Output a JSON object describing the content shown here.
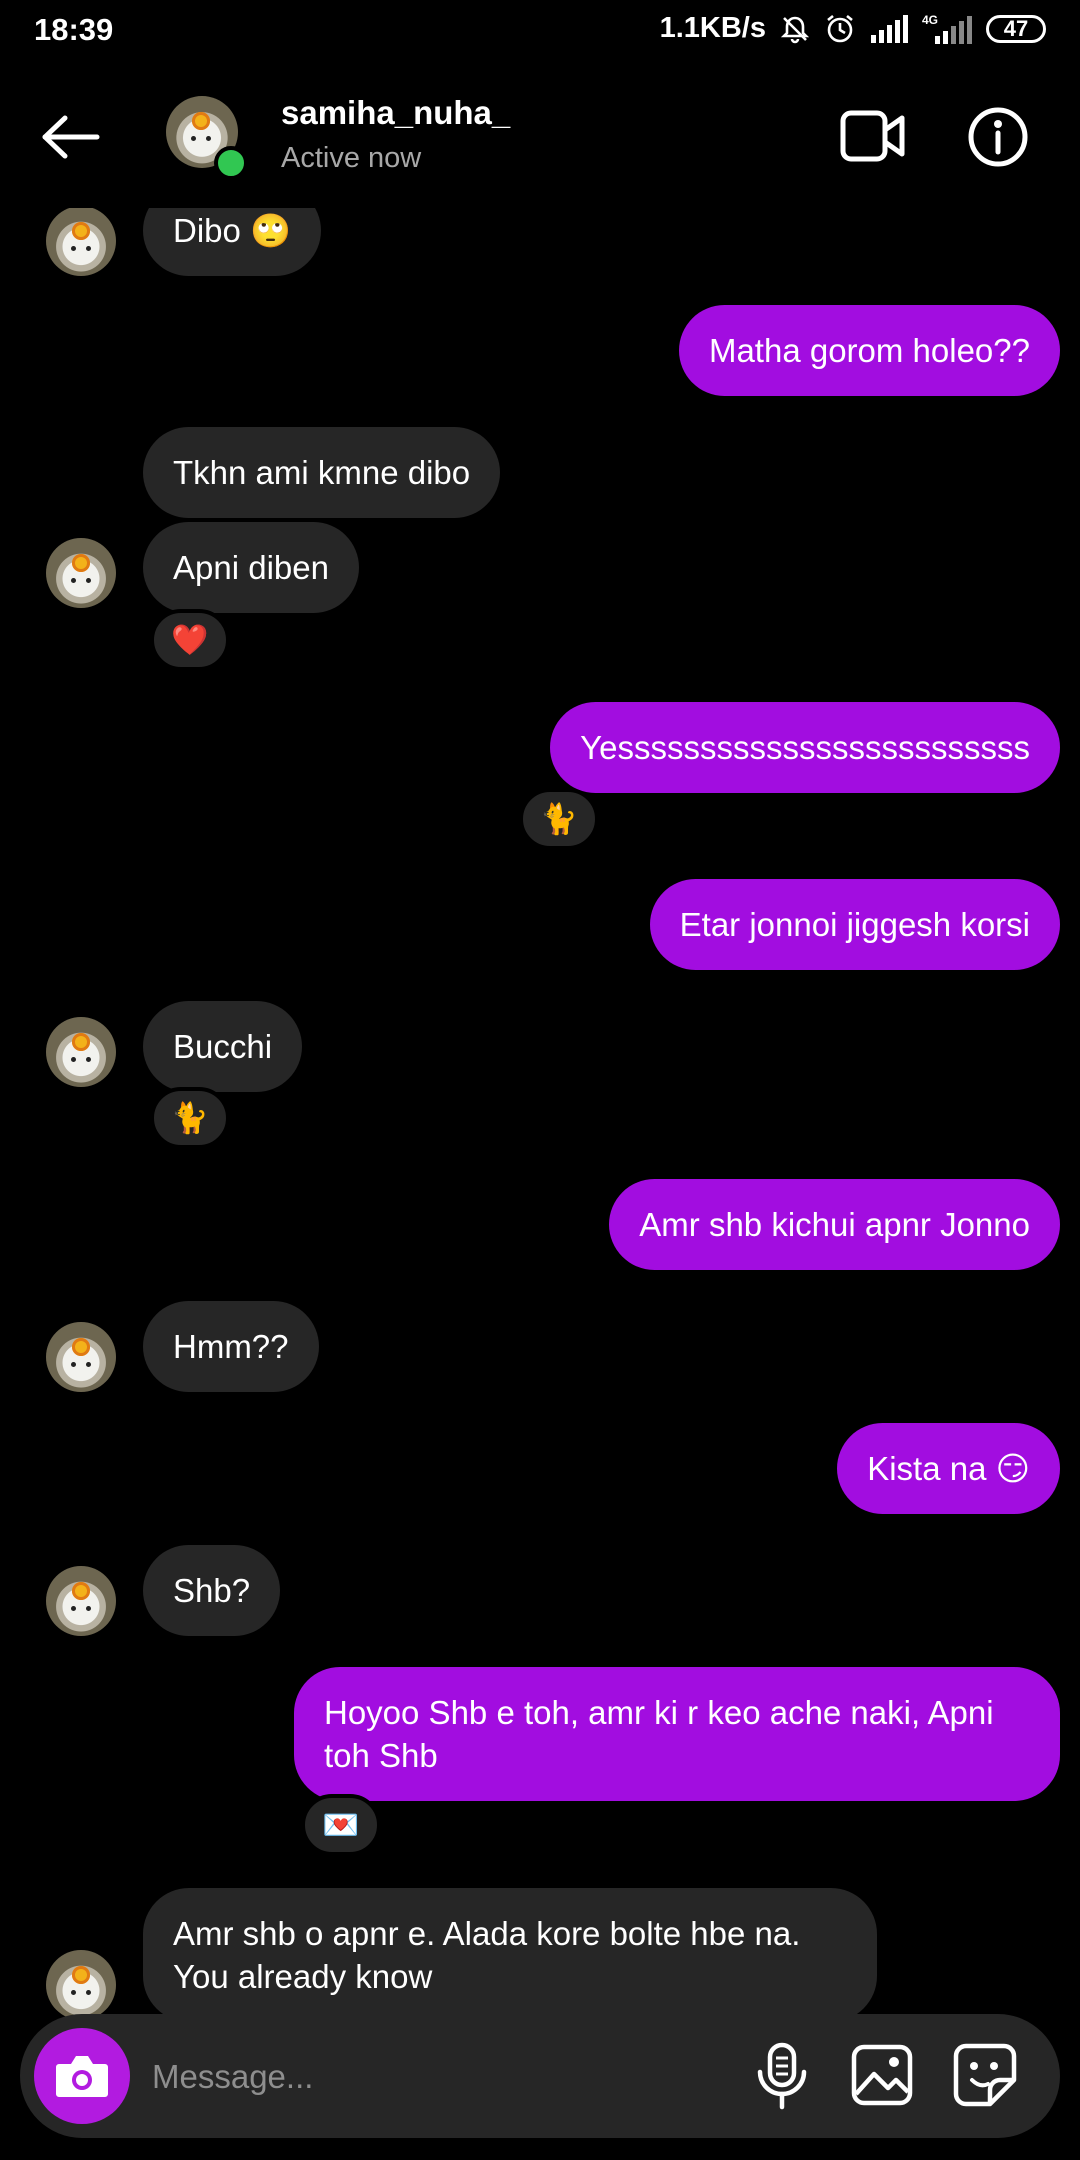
{
  "status_bar": {
    "time": "18:39",
    "network_speed": "1.1KB/s",
    "network_type": "4G",
    "battery": "47",
    "icons": [
      "mute-bell-icon",
      "alarm-icon",
      "signal-icon",
      "signal-4g-icon",
      "battery-icon"
    ]
  },
  "header": {
    "username": "samiha_nuha_",
    "presence": "Active now",
    "actions": [
      "back-arrow-icon",
      "video-call-icon",
      "info-icon"
    ]
  },
  "messages": {
    "m1": "Dibo 🙄",
    "m2": "Matha gorom holeo??",
    "m3": "Tkhn ami kmne dibo",
    "m4": "Apni diben",
    "m4_reaction": "❤️",
    "m5": "Yesssssssssssssssssssssssss",
    "m5_reaction": "🐈",
    "m6": "Etar jonnoi jiggesh korsi",
    "m7": "Bucchi",
    "m7_reaction": "🐈",
    "m8": "Amr shb kichui apnr Jonno",
    "m9": "Hmm??",
    "m10": "Kista na 😏",
    "m11": "Shb?",
    "m12": "Hoyoo Shb e toh, amr ki r keo ache naki, Apni toh Shb",
    "m12_reaction": "💌",
    "m13": "Amr shb o apnr e. Alada kore bolte hbe na. You already know"
  },
  "composer": {
    "placeholder": "Message...",
    "value": "",
    "icons": [
      "camera-icon",
      "microphone-icon",
      "gallery-icon",
      "sticker-icon"
    ]
  },
  "colors": {
    "background": "#000000",
    "incoming_bubble": "#262626",
    "outgoing_bubble": "#a20de0",
    "camera_button": "#b21be0",
    "online": "#31c752",
    "secondary_text": "#a8a8a8"
  }
}
